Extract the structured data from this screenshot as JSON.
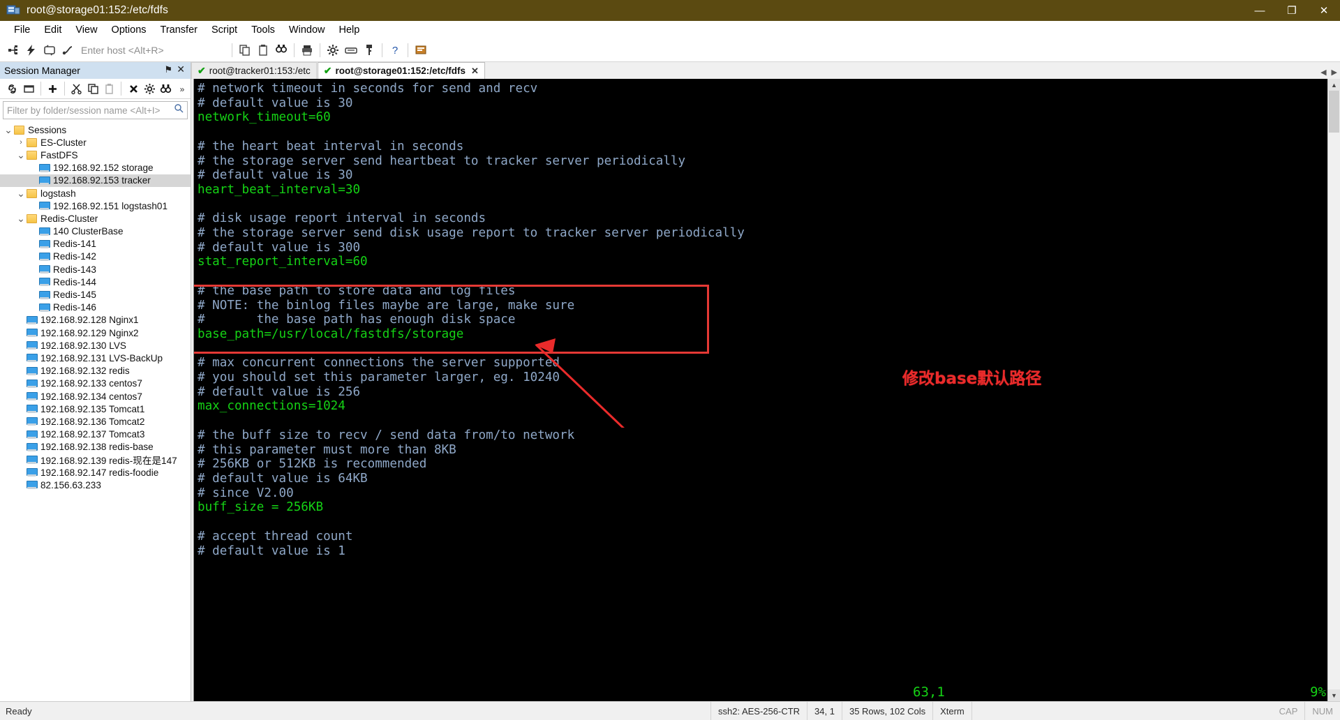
{
  "window": {
    "title": "root@storage01:152:/etc/fdfs",
    "icon": "securecrt-icon",
    "controls": {
      "minimize": "—",
      "maximize": "❐",
      "close": "✕"
    }
  },
  "menubar": {
    "items": [
      "File",
      "Edit",
      "View",
      "Options",
      "Transfer",
      "Script",
      "Tools",
      "Window",
      "Help"
    ]
  },
  "toolbar": {
    "host_placeholder": "Enter host <Alt+R>",
    "icons": [
      "connect-icon",
      "quick-connect-icon",
      "reconnect-icon",
      "connect-sftp-icon",
      "copy-icon",
      "paste-icon",
      "find-icon",
      "print-icon",
      "settings-icon",
      "keymap-icon",
      "key-icon",
      "help-icon",
      "chat-icon"
    ]
  },
  "session_manager": {
    "title": "Session Manager",
    "pin": "⚑",
    "close": "✕",
    "toolbar_icons": [
      "link-icon",
      "new-window-icon",
      "add-icon",
      "cut-icon",
      "copy-icon",
      "paste-icon",
      "delete-icon",
      "properties-icon",
      "binoculars-icon",
      "more-icon"
    ],
    "filter_placeholder": "Filter by folder/session name <Alt+I>",
    "search_icon": "search-icon",
    "tree": [
      {
        "label": "Sessions",
        "type": "folder",
        "indent": 0,
        "expanded": true,
        "selected": false
      },
      {
        "label": "ES-Cluster",
        "type": "folder",
        "indent": 1,
        "expanded": false,
        "selected": false
      },
      {
        "label": "FastDFS",
        "type": "folder",
        "indent": 1,
        "expanded": true,
        "selected": false
      },
      {
        "label": "192.168.92.152 storage",
        "type": "session",
        "indent": 2,
        "expanded": null,
        "selected": false
      },
      {
        "label": "192.168.92.153 tracker",
        "type": "session",
        "indent": 2,
        "expanded": null,
        "selected": true
      },
      {
        "label": "logstash",
        "type": "folder",
        "indent": 1,
        "expanded": true,
        "selected": false
      },
      {
        "label": "192.168.92.151 logstash01",
        "type": "session",
        "indent": 2,
        "expanded": null,
        "selected": false
      },
      {
        "label": "Redis-Cluster",
        "type": "folder",
        "indent": 1,
        "expanded": true,
        "selected": false
      },
      {
        "label": "140 ClusterBase",
        "type": "session",
        "indent": 2,
        "expanded": null,
        "selected": false
      },
      {
        "label": "Redis-141",
        "type": "session",
        "indent": 2,
        "expanded": null,
        "selected": false
      },
      {
        "label": "Redis-142",
        "type": "session",
        "indent": 2,
        "expanded": null,
        "selected": false
      },
      {
        "label": "Redis-143",
        "type": "session",
        "indent": 2,
        "expanded": null,
        "selected": false
      },
      {
        "label": "Redis-144",
        "type": "session",
        "indent": 2,
        "expanded": null,
        "selected": false
      },
      {
        "label": "Redis-145",
        "type": "session",
        "indent": 2,
        "expanded": null,
        "selected": false
      },
      {
        "label": "Redis-146",
        "type": "session",
        "indent": 2,
        "expanded": null,
        "selected": false
      },
      {
        "label": "192.168.92.128  Nginx1",
        "type": "session",
        "indent": 1,
        "expanded": null,
        "selected": false
      },
      {
        "label": "192.168.92.129  Nginx2",
        "type": "session",
        "indent": 1,
        "expanded": null,
        "selected": false
      },
      {
        "label": "192.168.92.130  LVS",
        "type": "session",
        "indent": 1,
        "expanded": null,
        "selected": false
      },
      {
        "label": "192.168.92.131  LVS-BackUp",
        "type": "session",
        "indent": 1,
        "expanded": null,
        "selected": false
      },
      {
        "label": "192.168.92.132  redis",
        "type": "session",
        "indent": 1,
        "expanded": null,
        "selected": false
      },
      {
        "label": "192.168.92.133  centos7",
        "type": "session",
        "indent": 1,
        "expanded": null,
        "selected": false
      },
      {
        "label": "192.168.92.134  centos7",
        "type": "session",
        "indent": 1,
        "expanded": null,
        "selected": false
      },
      {
        "label": "192.168.92.135  Tomcat1",
        "type": "session",
        "indent": 1,
        "expanded": null,
        "selected": false
      },
      {
        "label": "192.168.92.136  Tomcat2",
        "type": "session",
        "indent": 1,
        "expanded": null,
        "selected": false
      },
      {
        "label": "192.168.92.137  Tomcat3",
        "type": "session",
        "indent": 1,
        "expanded": null,
        "selected": false
      },
      {
        "label": "192.168.92.138 redis-base",
        "type": "session",
        "indent": 1,
        "expanded": null,
        "selected": false
      },
      {
        "label": "192.168.92.139 redis-现在是147",
        "type": "session",
        "indent": 1,
        "expanded": null,
        "selected": false
      },
      {
        "label": "192.168.92.147 redis-foodie",
        "type": "session",
        "indent": 1,
        "expanded": null,
        "selected": false
      },
      {
        "label": "82.156.63.233",
        "type": "session",
        "indent": 1,
        "expanded": null,
        "selected": false
      }
    ]
  },
  "tabs": [
    {
      "label": "root@storage01:152:/etc/fdfs",
      "active": true,
      "status_icon": "check-icon",
      "close_icon": "close-icon"
    },
    {
      "label": "root@tracker01:153:/etc",
      "active": false,
      "status_icon": "check-icon",
      "close_icon": null
    }
  ],
  "tab_nav": {
    "left": "◀",
    "right": "▶"
  },
  "terminal": {
    "lines": [
      {
        "text": "# network timeout in seconds for send and recv",
        "color": "comment"
      },
      {
        "text": "# default value is 30",
        "color": "comment"
      },
      {
        "text": "network_timeout=60",
        "color": "green"
      },
      {
        "text": "",
        "color": "blank"
      },
      {
        "text": "# the heart beat interval in seconds",
        "color": "comment"
      },
      {
        "text": "# the storage server send heartbeat to tracker server periodically",
        "color": "comment"
      },
      {
        "text": "# default value is 30",
        "color": "comment"
      },
      {
        "text": "heart_beat_interval=30",
        "color": "green"
      },
      {
        "text": "",
        "color": "blank"
      },
      {
        "text": "# disk usage report interval in seconds",
        "color": "comment"
      },
      {
        "text": "# the storage server send disk usage report to tracker server periodically",
        "color": "comment"
      },
      {
        "text": "# default value is 300",
        "color": "comment"
      },
      {
        "text": "stat_report_interval=60",
        "color": "green"
      },
      {
        "text": "",
        "color": "blank"
      },
      {
        "text": "# the base path to store data and log files",
        "color": "comment"
      },
      {
        "text": "# NOTE: the binlog files maybe are large, make sure",
        "color": "comment"
      },
      {
        "text": "#       the base path has enough disk space",
        "color": "comment"
      },
      {
        "text": "base_path=/usr/local/fastdfs/storage",
        "color": "green"
      },
      {
        "text": "",
        "color": "blank"
      },
      {
        "text": "# max concurrent connections the server supported",
        "color": "comment"
      },
      {
        "text": "# you should set this parameter larger, eg. 10240",
        "color": "comment"
      },
      {
        "text": "# default value is 256",
        "color": "comment"
      },
      {
        "text": "max_connections=1024",
        "color": "green"
      },
      {
        "text": "",
        "color": "blank"
      },
      {
        "text": "# the buff size to recv / send data from/to network",
        "color": "comment"
      },
      {
        "text": "# this parameter must more than 8KB",
        "color": "comment"
      },
      {
        "text": "# 256KB or 512KB is recommended",
        "color": "comment"
      },
      {
        "text": "# default value is 64KB",
        "color": "comment"
      },
      {
        "text": "# since V2.00",
        "color": "comment"
      },
      {
        "text": "buff_size = 256KB",
        "color": "green"
      },
      {
        "text": "",
        "color": "blank"
      },
      {
        "text": "# accept thread count",
        "color": "comment"
      },
      {
        "text": "# default value is 1",
        "color": "comment"
      }
    ],
    "cursor_position": "63,1",
    "scroll_percent": "9%",
    "annotation": {
      "text": "修改base默认路径",
      "color": "#ea2b2b"
    }
  },
  "statusbar": {
    "ready": "Ready",
    "encryption": "ssh2: AES-256-CTR",
    "cursor": "34,  1",
    "geometry": "35 Rows, 102 Cols",
    "emulation": "Xterm",
    "caps": "CAP",
    "num": "NUM"
  },
  "colors": {
    "titlebar": "#5b4a11",
    "terminal_bg": "#000000",
    "comment": "#8fa8c8",
    "value": "#15d215",
    "accent_red": "#e53935",
    "sm_header": "#cfe0f0"
  }
}
